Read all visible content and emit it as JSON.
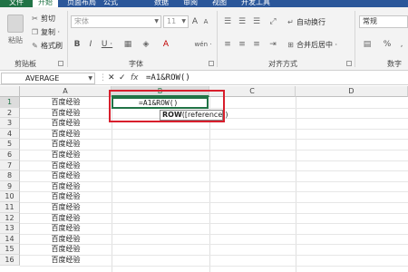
{
  "ribbon_tabs": [
    "文件",
    "开始",
    "页面布局",
    "公式",
    "数据",
    "审阅",
    "视图",
    "开发工具"
  ],
  "clipboard": {
    "paste_label": "粘贴",
    "cut_label": "剪切",
    "copy_label": "复制 ·",
    "format_painter_label": "格式刷",
    "group_label": "剪贴板"
  },
  "font": {
    "font_name": "宋体",
    "font_size": "11",
    "bold": "B",
    "italic": "I",
    "underline": "U ·",
    "grow": "A",
    "shrink": "A",
    "font_color_btn": "A",
    "wen_btn": "wén ·",
    "group_label": "字体"
  },
  "alignment": {
    "wrap_label": "自动换行",
    "merge_label": "合并后居中 ·",
    "group_label": "对齐方式"
  },
  "number": {
    "format": "常规",
    "percent": "%",
    "group_label": "数字"
  },
  "formula_bar": {
    "name_box": "AVERAGE",
    "cancel": "✕",
    "enter": "✓",
    "fx": "fx",
    "content": "=A1&ROW()"
  },
  "columns": [
    "A",
    "B",
    "C",
    "D"
  ],
  "rows": [
    "1",
    "2",
    "3",
    "4",
    "5",
    "6",
    "7",
    "8",
    "9",
    "10",
    "11",
    "12",
    "13",
    "14",
    "15",
    "16"
  ],
  "col_a_values": [
    "百度经验",
    "百度经验",
    "百度经验",
    "百度经验",
    "百度经验",
    "百度经验",
    "百度经验",
    "百度经验",
    "百度经验",
    "百度经验",
    "百度经验",
    "百度经验",
    "百度经验",
    "百度经验",
    "百度经验",
    "百度经验"
  ],
  "edit_cell": {
    "value": "=A1&ROW()",
    "tooltip_func": "ROW",
    "tooltip_args": "([reference])"
  },
  "colors": {
    "accent": "#217346",
    "highlight": "#d81e2c"
  }
}
